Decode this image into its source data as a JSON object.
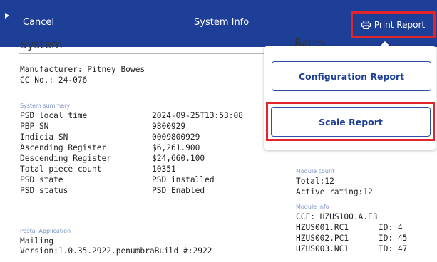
{
  "header": {
    "cancel_label": "Cancel",
    "title": "System Info",
    "print_label": "Print Report"
  },
  "system": {
    "title": "System",
    "manufacturer": "Manufacturer: Pitney Bowes",
    "cc_no": "CC No.: 24-076",
    "summary_label": "System summary",
    "summary": [
      {
        "key": "PSD local time",
        "value": "2024-09-25T13:53:08"
      },
      {
        "key": "PBP SN",
        "value": "9800929"
      },
      {
        "key": "Indicia SN",
        "value": "0009800929"
      },
      {
        "key": "Ascending Register",
        "value": "$6,261.900"
      },
      {
        "key": "Descending Register",
        "value": "$24,660.100"
      },
      {
        "key": "Total piece count",
        "value": "10351"
      },
      {
        "key": "PSD state",
        "value": "PSD installed"
      },
      {
        "key": "PSD status",
        "value": "PSD Enabled"
      }
    ],
    "postal_label": "Postal Application",
    "postal_name": "Mailing",
    "version": "Version:1.0.35.2922.penumbraBuild #:2922"
  },
  "rates": {
    "title": "Rates",
    "module_count_label": "Module count",
    "total": "Total:12",
    "active": "Active rating:12",
    "module_info_label": "Module info",
    "ccf": "CCF: HZUS100.A.E3",
    "modules": [
      {
        "name": "HZUS001.RC1",
        "id": "ID: 4"
      },
      {
        "name": "HZUS002.PC1",
        "id": "ID: 45"
      },
      {
        "name": "HZUS003.NC1",
        "id": "ID: 47"
      }
    ]
  },
  "popover": {
    "configuration_report": "Configuration Report",
    "scale_report": "Scale Report"
  },
  "colors": {
    "header_bg": "#1e3f97",
    "highlight_red": "#e1252a",
    "button_text": "#1e3f97"
  }
}
